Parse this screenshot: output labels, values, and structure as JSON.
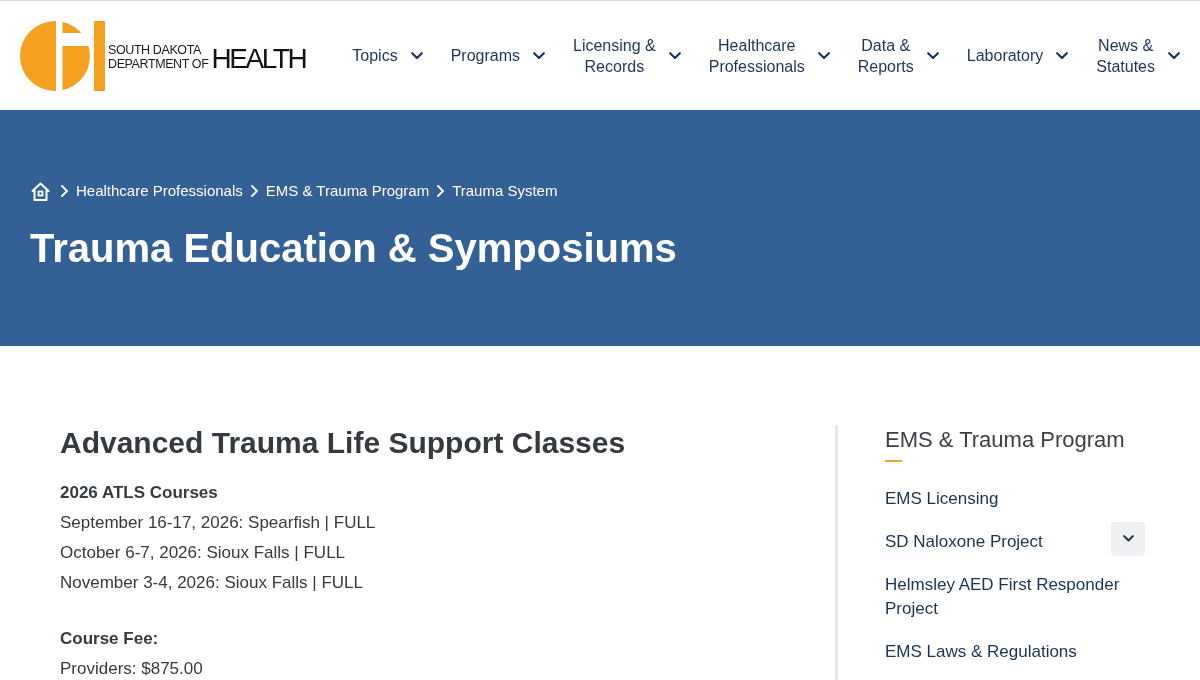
{
  "header": {
    "logo": {
      "small_lines": [
        "SOUTH DAKOTA",
        "DEPARTMENT OF"
      ],
      "wordmark": "HEALTH"
    },
    "nav": [
      {
        "lines": [
          "Topics"
        ]
      },
      {
        "lines": [
          "Programs"
        ]
      },
      {
        "lines": [
          "Licensing &",
          "Records"
        ]
      },
      {
        "lines": [
          "Healthcare",
          "Professionals"
        ]
      },
      {
        "lines": [
          "Data &",
          "Reports"
        ]
      },
      {
        "lines": [
          "Laboratory"
        ]
      },
      {
        "lines": [
          "News &",
          "Statutes"
        ]
      }
    ]
  },
  "banner": {
    "breadcrumb": [
      "Healthcare Professionals",
      "EMS & Trauma Program",
      "Trauma System"
    ],
    "title": "Trauma Education & Symposiums"
  },
  "main": {
    "heading": "Advanced Trauma Life Support Classes",
    "sections": [
      {
        "title": "2026 ATLS Courses",
        "lines": [
          "September 16-17, 2026: Spearfish | FULL",
          "October 6-7, 2026: Sioux Falls | FULL",
          "November 3-4, 2026: Sioux Falls | FULL"
        ]
      },
      {
        "title": "Course Fee:",
        "lines": [
          "Providers: $875.00"
        ]
      }
    ]
  },
  "sidebar": {
    "title": "EMS & Trauma Program",
    "links": [
      {
        "label": "EMS Licensing",
        "has_submenu": false
      },
      {
        "label": "SD Naloxone Project",
        "has_submenu": true
      },
      {
        "label": "Helmsley AED First Responder Project",
        "has_submenu": false
      },
      {
        "label": "EMS Laws & Regulations",
        "has_submenu": false
      }
    ]
  }
}
